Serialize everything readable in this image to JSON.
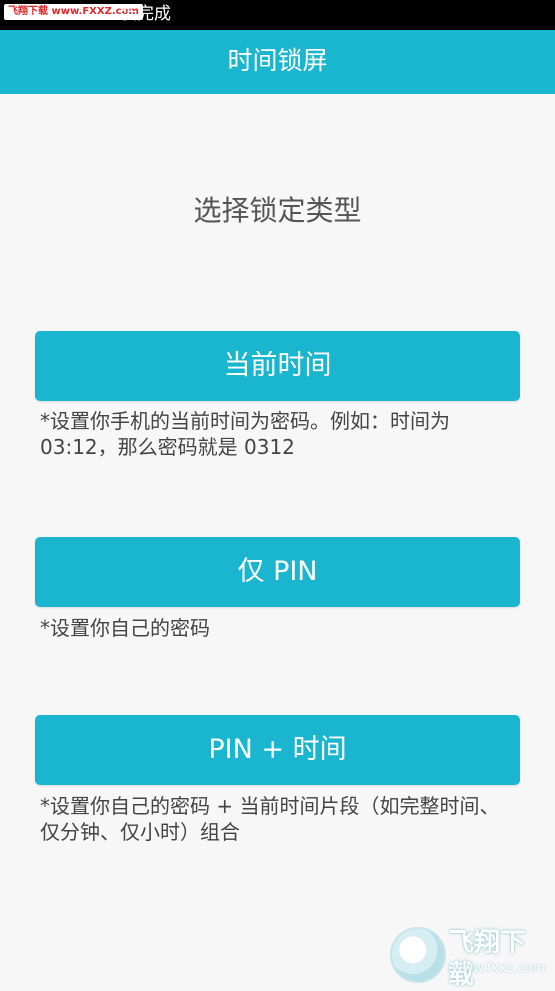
{
  "status_bar": {
    "watermark": "飞翔下载 www.FXXZ.com",
    "text": "装完成"
  },
  "app_bar": {
    "title": "时间锁屏"
  },
  "heading": "选择锁定类型",
  "options": [
    {
      "label": "当前时间",
      "description": "*设置你手机的当前时间为密码。例如：时间为 03:12，那么密码就是 0312"
    },
    {
      "label": "仅 PIN",
      "description": "*设置你自己的密码"
    },
    {
      "label": "PIN + 时间",
      "description": "*设置你自己的密码 + 当前时间片段（如完整时间、仅分钟、仅小时）组合"
    }
  ],
  "watermark_corner": {
    "title": "飞翔下载",
    "url": "www.fxxz.com"
  },
  "colors": {
    "accent": "#1ab6cf",
    "background": "#f7f7f7",
    "status_bar": "#000000"
  }
}
